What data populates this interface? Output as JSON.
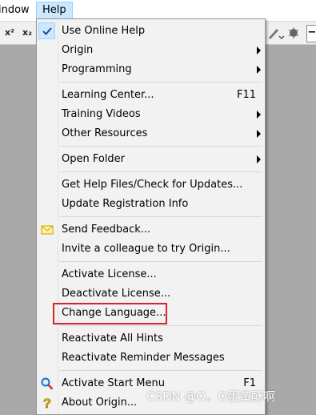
{
  "menubar": {
    "window_label": "indow",
    "help_label": "Help"
  },
  "toolbar": {
    "superscript_label": "x²",
    "subscript_label": "x₂",
    "minus_label": "−"
  },
  "menu": {
    "use_online_help": "Use Online Help",
    "origin": "Origin",
    "programming": "Programming",
    "learning_center": "Learning Center...",
    "learning_center_shortcut": "F11",
    "training_videos": "Training Videos",
    "other_resources": "Other Resources",
    "open_folder": "Open Folder",
    "get_help_files": "Get Help Files/Check for Updates...",
    "update_registration": "Update Registration Info",
    "send_feedback": "Send Feedback...",
    "invite_colleague": "Invite a colleague to try Origin...",
    "activate_license": "Activate License...",
    "deactivate_license": "Deactivate License...",
    "change_language": "Change Language...",
    "reactivate_hints": "Reactivate All Hints",
    "reactivate_reminders": "Reactivate Reminder Messages",
    "activate_start_menu": "Activate Start Menu",
    "activate_start_menu_shortcut": "F1",
    "about_origin": "About Origin..."
  },
  "watermark": "CSDN @O。O蛋黄酥啊",
  "colors": {
    "highlight_border": "#d9232b",
    "menu_bg": "#f2f2f2",
    "selected_bg": "#cce8ff"
  }
}
